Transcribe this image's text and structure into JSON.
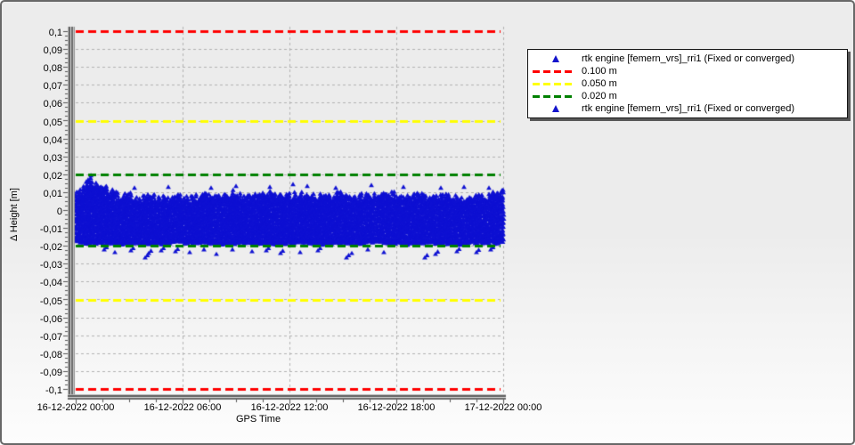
{
  "window": {
    "background_top": "#ececec",
    "background_bottom": "#fdfdfd",
    "border_color": "#686868"
  },
  "chart_data": {
    "type": "scatter",
    "title": "",
    "xlabel": "GPS Time",
    "ylabel": "Δ Height [m]",
    "x_tick_labels": [
      "16-12-2022 00:00",
      "16-12-2022 06:00",
      "16-12-2022 12:00",
      "16-12-2022 18:00",
      "17-12-2022 00:00"
    ],
    "x_range_hours": [
      0,
      24
    ],
    "x_major_step_hours": 6,
    "x_minor_step_hours": 1.5,
    "ylim": [
      -0.1,
      0.1
    ],
    "y_tick_step": 0.01,
    "y_tick_labels": [
      "0,1",
      "0,09",
      "0,08",
      "0,07",
      "0,06",
      "0,05",
      "0,04",
      "0,03",
      "0,02",
      "0,01",
      "0",
      "-0,01",
      "-0,02",
      "-0,03",
      "-0,04",
      "-0,05",
      "-0,06",
      "-0,07",
      "-0,08",
      "-0,09",
      "-0,1"
    ],
    "grid": {
      "show": true,
      "color": "#b2b2b2",
      "style": "dashed"
    },
    "axis_color": "#5e5e5e",
    "thresholds": [
      {
        "value": 0.1,
        "mirrored": true,
        "color": "#ff0000",
        "label": "0.100 m"
      },
      {
        "value": 0.05,
        "mirrored": true,
        "color": "#ffff00",
        "label": "0.050 m"
      },
      {
        "value": 0.02,
        "mirrored": true,
        "color": "#008000",
        "label": "0.020 m"
      }
    ],
    "series": [
      {
        "name": "rtk engine [femern_vrs]_rri1 (Fixed or converged)",
        "marker": "triangle-up",
        "color": "#0e10d2",
        "band_envelope_hour_top_bottom_m": [
          [
            0,
            0.011,
            -0.018
          ],
          [
            0.5,
            0.014,
            -0.019
          ],
          [
            0.8,
            0.021,
            -0.0185
          ],
          [
            1.0,
            0.018,
            -0.019
          ],
          [
            1.3,
            0.013,
            -0.019
          ],
          [
            1.6,
            0.015,
            -0.0185
          ],
          [
            2.0,
            0.012,
            -0.019
          ],
          [
            2.5,
            0.009,
            -0.0195
          ],
          [
            3.0,
            0.011,
            -0.019
          ],
          [
            3.5,
            0.008,
            -0.0185
          ],
          [
            4.2,
            0.01,
            -0.0195
          ],
          [
            5.0,
            0.008,
            -0.019
          ],
          [
            5.8,
            0.009,
            -0.0185
          ],
          [
            6.5,
            0.008,
            -0.019
          ],
          [
            7.2,
            0.011,
            -0.0185
          ],
          [
            8.0,
            0.009,
            -0.0195
          ],
          [
            8.8,
            0.012,
            -0.019
          ],
          [
            9.5,
            0.008,
            -0.0185
          ],
          [
            10.2,
            0.01,
            -0.019
          ],
          [
            11.0,
            0.011,
            -0.0195
          ],
          [
            11.8,
            0.009,
            -0.019
          ],
          [
            12.5,
            0.011,
            -0.0185
          ],
          [
            13.2,
            0.009,
            -0.019
          ],
          [
            14.0,
            0.01,
            -0.0195
          ],
          [
            14.8,
            0.011,
            -0.0185
          ],
          [
            15.5,
            0.008,
            -0.019
          ],
          [
            16.2,
            0.01,
            -0.019
          ],
          [
            17.0,
            0.009,
            -0.0185
          ],
          [
            17.8,
            0.011,
            -0.019
          ],
          [
            18.5,
            0.008,
            -0.0195
          ],
          [
            19.2,
            0.01,
            -0.019
          ],
          [
            20.0,
            0.009,
            -0.0185
          ],
          [
            20.8,
            0.01,
            -0.019
          ],
          [
            21.5,
            0.008,
            -0.0195
          ],
          [
            22.2,
            0.01,
            -0.019
          ],
          [
            23.0,
            0.009,
            -0.0185
          ],
          [
            23.7,
            0.011,
            -0.019
          ],
          [
            24,
            0.012,
            -0.018
          ]
        ],
        "top_outliers_hour_m": [
          [
            3.3,
            0.0125
          ],
          [
            5.2,
            0.013
          ],
          [
            7.6,
            0.0125
          ],
          [
            9.0,
            0.0135
          ],
          [
            10.9,
            0.013
          ],
          [
            12.2,
            0.0145
          ],
          [
            13.0,
            0.0135
          ],
          [
            14.6,
            0.0125
          ],
          [
            16.6,
            0.014
          ],
          [
            18.4,
            0.013
          ],
          [
            20.5,
            0.0125
          ],
          [
            21.8,
            0.013
          ],
          [
            23.2,
            0.0125
          ]
        ],
        "bottom_outliers_hour_m": [
          [
            1.6,
            -0.022
          ],
          [
            2.2,
            -0.0235
          ],
          [
            3.1,
            -0.0225
          ],
          [
            3.9,
            -0.0265
          ],
          [
            4.1,
            -0.024
          ],
          [
            4.8,
            -0.0225
          ],
          [
            5.6,
            -0.023
          ],
          [
            6.4,
            -0.0235
          ],
          [
            7.2,
            -0.022
          ],
          [
            7.9,
            -0.0245
          ],
          [
            8.8,
            -0.022
          ],
          [
            9.9,
            -0.023
          ],
          [
            10.7,
            -0.0225
          ],
          [
            11.5,
            -0.024
          ],
          [
            12.6,
            -0.0235
          ],
          [
            13.6,
            -0.0225
          ],
          [
            15.2,
            -0.0265
          ],
          [
            15.5,
            -0.024
          ],
          [
            16.4,
            -0.022
          ],
          [
            17.3,
            -0.0235
          ],
          [
            19.6,
            -0.0265
          ],
          [
            20.2,
            -0.0245
          ],
          [
            21.4,
            -0.023
          ],
          [
            22.5,
            -0.0235
          ],
          [
            23.3,
            -0.022
          ]
        ]
      }
    ],
    "legend": {
      "position": "right-top",
      "entries": [
        {
          "marker": "triangle",
          "color": "#1414cc",
          "label": "rtk engine [femern_vrs]_rri1 (Fixed or converged)"
        },
        {
          "marker": "dashed-line",
          "color": "#ff0000",
          "label": "0.100 m"
        },
        {
          "marker": "dashed-line",
          "color": "#ffff00",
          "label": "0.050 m"
        },
        {
          "marker": "dashed-line",
          "color": "#008000",
          "label": "0.020 m"
        },
        {
          "marker": "triangle",
          "color": "#1414cc",
          "label": "rtk engine [femern_vrs]_rri1 (Fixed or converged)"
        }
      ]
    }
  }
}
